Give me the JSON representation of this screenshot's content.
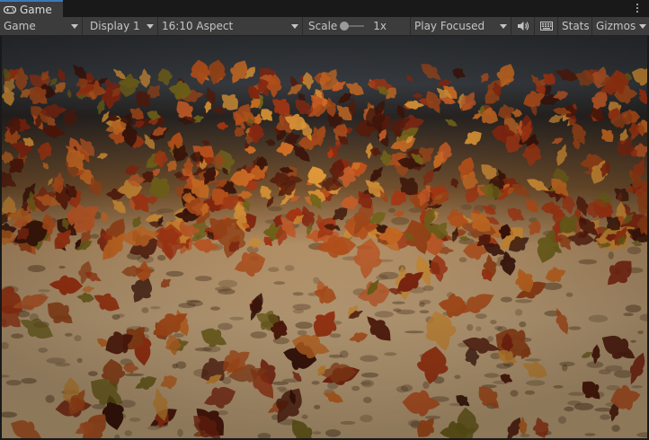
{
  "window": {
    "tab_label": "Game",
    "tab_icon": "gamepad-icon",
    "menu_icon": "kebab-menu-icon"
  },
  "toolbar": {
    "view_mode": "Game",
    "display": "Display 1",
    "aspect": "16:10 Aspect",
    "scale_label": "Scale",
    "scale_value": "1x",
    "play_mode": "Play Focused",
    "audio_icon": "speaker-icon",
    "keyboard_icon": "keyboard-icon",
    "stats_label": "Stats",
    "gizmos_label": "Gizmos"
  },
  "viewport": {
    "scene": "falling-autumn-leaves-over-sand"
  },
  "colors": {
    "tab_accent": "#3a79bb",
    "toolbar_bg": "#3c3c3c",
    "sky": "#2e3135",
    "sand": "#d4b283",
    "leaf_red": "#b23a14",
    "leaf_orange": "#d97326",
    "leaf_brown": "#4a1a0e",
    "leaf_green": "#7a6a1c"
  }
}
